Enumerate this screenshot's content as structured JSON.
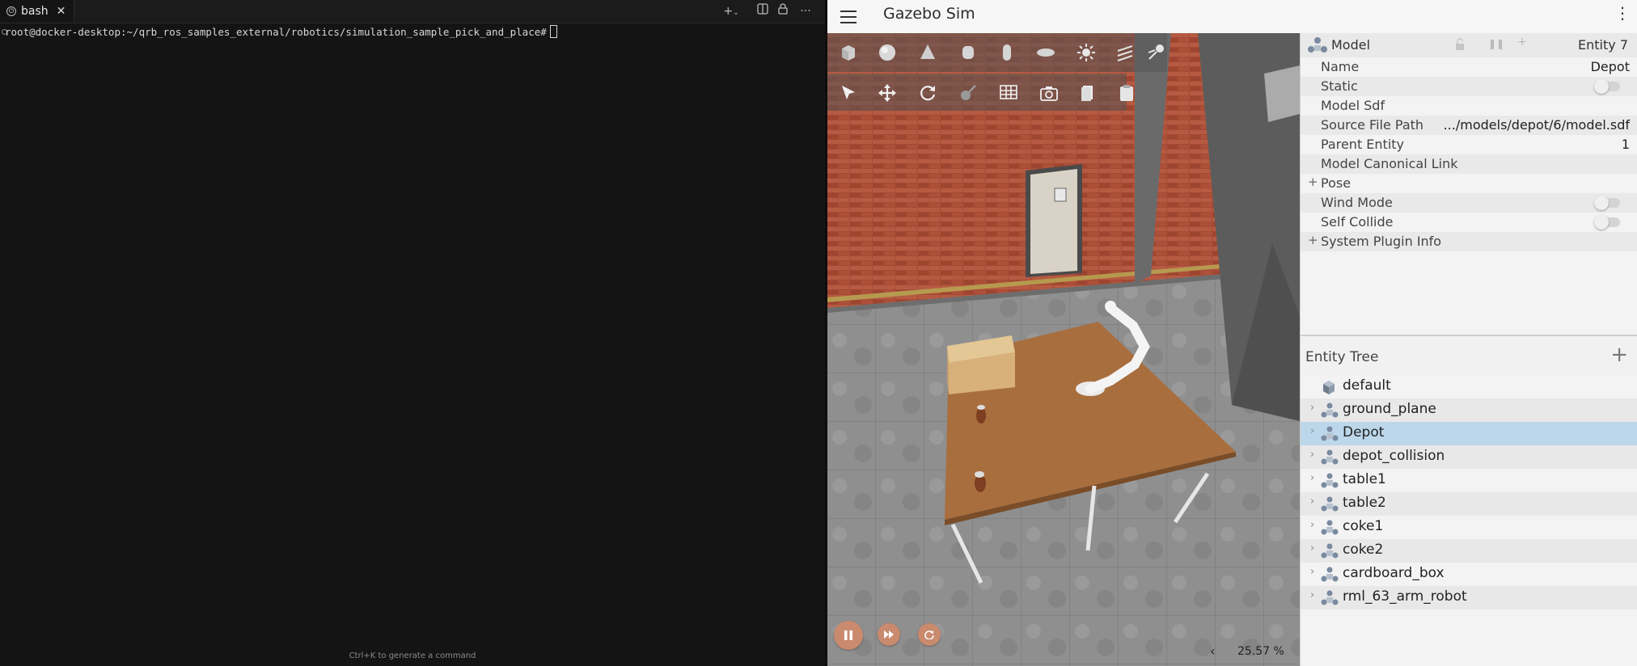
{
  "terminal": {
    "tab_label": "bash",
    "prompt": "root@docker-desktop:~/qrb_ros_samples_external/robotics/simulation_sample_pick_and_place#",
    "hint": "Ctrl+K to generate a command",
    "toolbar": {
      "new": "+",
      "more": "···"
    }
  },
  "gazebo": {
    "title": "Gazebo Sim",
    "component_inspector": {
      "type_label": "Model",
      "entity_label": "Entity 7",
      "properties": [
        {
          "key": "Name",
          "value": "Depot"
        },
        {
          "key": "Static",
          "value": ""
        },
        {
          "key": "Model Sdf",
          "value": ""
        },
        {
          "key": "Source File Path",
          "value": ".../models/depot/6/model.sdf"
        },
        {
          "key": "Parent Entity",
          "value": "1"
        },
        {
          "key": "Model Canonical Link",
          "value": ""
        },
        {
          "key": "Pose",
          "value": ""
        },
        {
          "key": "Wind Mode",
          "value": ""
        },
        {
          "key": "Self Collide",
          "value": ""
        },
        {
          "key": "System Plugin Info",
          "value": ""
        }
      ]
    },
    "entity_tree": {
      "title": "Entity Tree",
      "items": [
        "default",
        "ground_plane",
        "Depot",
        "depot_collision",
        "table1",
        "table2",
        "coke1",
        "coke2",
        "cardboard_box",
        "rml_63_arm_robot"
      ],
      "selected": "Depot"
    },
    "real_time_factor": "25.57 %"
  }
}
